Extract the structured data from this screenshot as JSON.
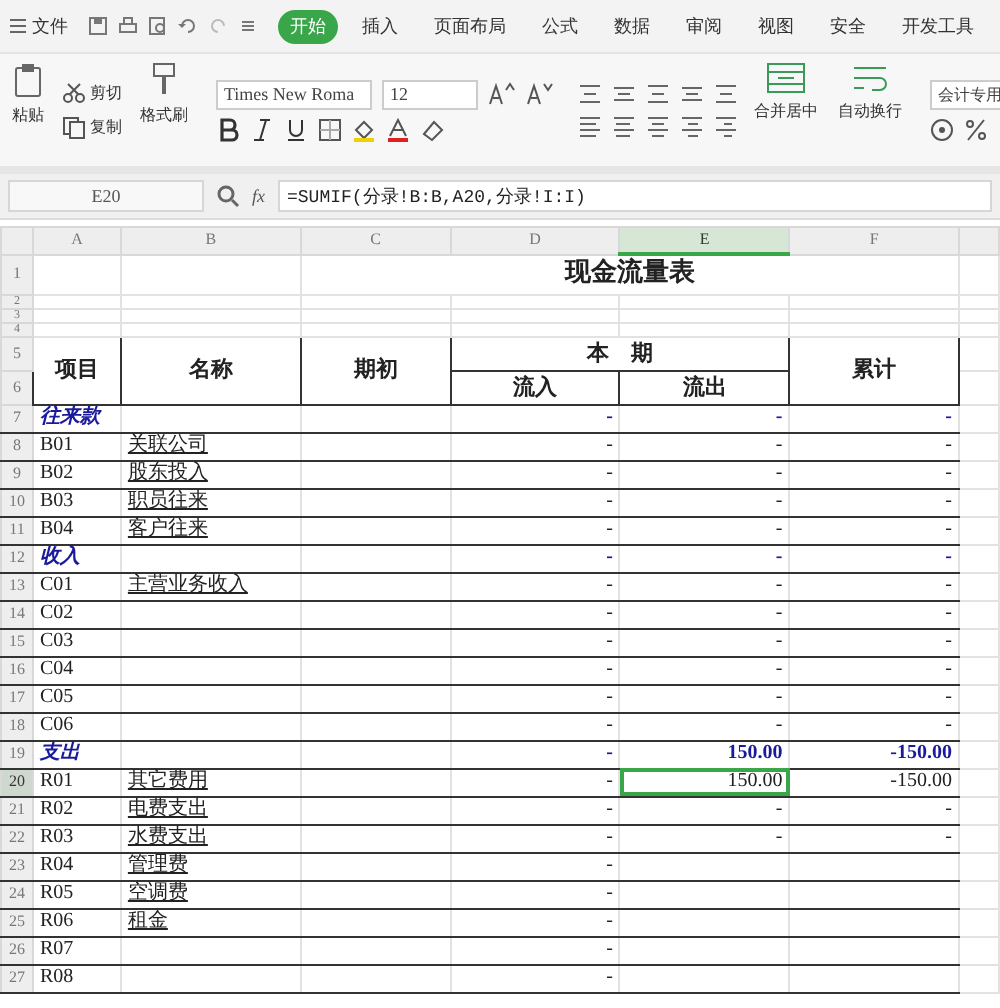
{
  "menu": {
    "file": "文件",
    "tabs": [
      {
        "label": "开始",
        "selected": true
      },
      {
        "label": "插入",
        "selected": false
      },
      {
        "label": "页面布局",
        "selected": false
      },
      {
        "label": "公式",
        "selected": false
      },
      {
        "label": "数据",
        "selected": false
      },
      {
        "label": "审阅",
        "selected": false
      },
      {
        "label": "视图",
        "selected": false
      },
      {
        "label": "安全",
        "selected": false
      },
      {
        "label": "开发工具",
        "selected": false
      }
    ]
  },
  "ribbon": {
    "paste": "粘贴",
    "cut": "剪切",
    "copy": "复制",
    "format_painter": "格式刷",
    "font": "Times New Roma",
    "font_size": "12",
    "merge": "合并居中",
    "wrap": "自动换行",
    "number_format": "会计专用"
  },
  "formula_bar": {
    "name_box": "E20",
    "fx": "fx",
    "formula": "=SUMIF(分录!B:B,A20,分录!I:I)"
  },
  "sheet": {
    "columns": [
      {
        "label": "A",
        "selected": false
      },
      {
        "label": "B",
        "selected": false
      },
      {
        "label": "C",
        "selected": false
      },
      {
        "label": "D",
        "selected": false
      },
      {
        "label": "E",
        "selected": true
      },
      {
        "label": "F",
        "selected": false
      }
    ],
    "title": {
      "row": "1",
      "text": "现金流量表"
    },
    "blank_rows": [
      "2",
      "3",
      "4"
    ],
    "header": {
      "rows": [
        "5",
        "6"
      ],
      "item": "项目",
      "name": "名称",
      "opening": "期初",
      "period": "本　期",
      "inflow": "流入",
      "outflow": "流出",
      "total": "累计"
    },
    "rows": [
      {
        "row": "7",
        "kind": "category",
        "code": "往来款",
        "inflow": "-",
        "outflow": "-",
        "total": "-",
        "selected": false
      },
      {
        "row": "8",
        "kind": "item",
        "code": "B01",
        "name": "关联公司",
        "inflow": "-",
        "outflow": "-",
        "total": "-",
        "selected": false
      },
      {
        "row": "9",
        "kind": "item",
        "code": "B02",
        "name": "股东投入",
        "inflow": "-",
        "outflow": "-",
        "total": "-",
        "selected": false
      },
      {
        "row": "10",
        "kind": "item",
        "code": "B03",
        "name": "职员往来",
        "inflow": "-",
        "outflow": "-",
        "total": "-",
        "selected": false
      },
      {
        "row": "11",
        "kind": "item",
        "code": "B04",
        "name": "客户往来",
        "inflow": "-",
        "outflow": "-",
        "total": "-",
        "selected": false
      },
      {
        "row": "12",
        "kind": "category",
        "code": "收入",
        "inflow": "-",
        "outflow": "-",
        "total": "-",
        "selected": false
      },
      {
        "row": "13",
        "kind": "item",
        "code": "C01",
        "name": "主营业务收入",
        "inflow": "-",
        "outflow": "-",
        "total": "-",
        "selected": false
      },
      {
        "row": "14",
        "kind": "item",
        "code": "C02",
        "inflow": "-",
        "outflow": "-",
        "total": "-",
        "selected": false
      },
      {
        "row": "15",
        "kind": "item",
        "code": "C03",
        "inflow": "-",
        "outflow": "-",
        "total": "-",
        "selected": false
      },
      {
        "row": "16",
        "kind": "item",
        "code": "C04",
        "inflow": "-",
        "outflow": "-",
        "total": "-",
        "selected": false
      },
      {
        "row": "17",
        "kind": "item",
        "code": "C05",
        "inflow": "-",
        "outflow": "-",
        "total": "-",
        "selected": false
      },
      {
        "row": "18",
        "kind": "item",
        "code": "C06",
        "inflow": "-",
        "outflow": "-",
        "total": "-",
        "selected": false
      },
      {
        "row": "19",
        "kind": "category",
        "code": "支出",
        "inflow": "-",
        "outflow": "150.00",
        "total": "-150.00",
        "selected": false
      },
      {
        "row": "20",
        "kind": "item",
        "code": "R01",
        "name": "其它费用",
        "inflow": "-",
        "outflow": "150.00",
        "total": "-150.00",
        "selected": true
      },
      {
        "row": "21",
        "kind": "item",
        "code": "R02",
        "name": "电费支出",
        "inflow": "-",
        "outflow": "-",
        "total": "-",
        "selected": false
      },
      {
        "row": "22",
        "kind": "item",
        "code": "R03",
        "name": "水费支出",
        "inflow": "-",
        "outflow": "-",
        "total": "-",
        "selected": false
      },
      {
        "row": "23",
        "kind": "item",
        "code": "R04",
        "name": "管理费",
        "inflow": "-",
        "selected": false
      },
      {
        "row": "24",
        "kind": "item",
        "code": "R05",
        "name": "空调费",
        "inflow": "-",
        "selected": false
      },
      {
        "row": "25",
        "kind": "item",
        "code": "R06",
        "name": "租金",
        "inflow": "-",
        "selected": false
      },
      {
        "row": "26",
        "kind": "item",
        "code": "R07",
        "inflow": "-",
        "selected": false
      },
      {
        "row": "27",
        "kind": "item",
        "code": "R08",
        "inflow": "-",
        "selected": false
      }
    ]
  }
}
